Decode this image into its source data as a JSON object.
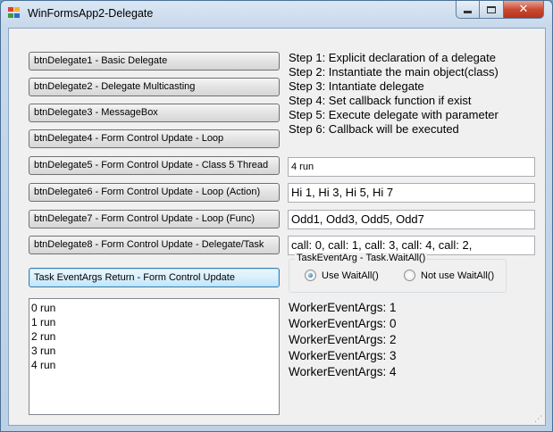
{
  "window": {
    "title": "WinFormsApp2-Delegate",
    "controls": {
      "close": "✕"
    }
  },
  "buttons": [
    "btnDelegate1 - Basic Delegate",
    "btnDelegate2 - Delegate Multicasting",
    "btnDelegate3 - MessageBox",
    "btnDelegate4 - Form Control Update - Loop",
    "btnDelegate5 - Form Control Update - Class 5 Thread",
    "btnDelegate6 - Form Control Update - Loop (Action)",
    "btnDelegate7 - Form Control Update - Loop (Func)",
    "btnDelegate8 - Form Control Update - Delegate/Task",
    "Task EventArgs Return - Form Control Update"
  ],
  "steps": [
    "Step 1: Explicit declaration of a delegate",
    "Step 2: Instantiate the main object(class)",
    "Step 3: Intantiate delegate",
    "Step 4: Set callback function if exist",
    "Step 5: Execute delegate with parameter",
    "Step 6: Callback will be executed"
  ],
  "textboxes": [
    "4 run",
    "Hi 1, Hi 3, Hi 5, Hi 7",
    "Odd1, Odd3, Odd5, Odd7",
    "call: 0, call: 1, call: 3, call: 4, call: 2,"
  ],
  "groupbox": {
    "title": "TaskEventArg - Task.WaitAll()",
    "options": [
      {
        "label": "Use WaitAll()",
        "checked": true
      },
      {
        "label": "Not use WaitAll()",
        "checked": false
      }
    ]
  },
  "listbox_items": [
    "0 run",
    "1 run",
    "2 run",
    "3 run",
    "4 run"
  ],
  "events": [
    "WorkerEventArgs: 1",
    "WorkerEventArgs: 0",
    "WorkerEventArgs: 2",
    "WorkerEventArgs: 3",
    "WorkerEventArgs: 4"
  ],
  "colors": {
    "icon_q1": "#e53c2f",
    "icon_q2": "#f6b12c",
    "icon_q3": "#3f9b3c",
    "icon_q4": "#2c6bd1"
  }
}
